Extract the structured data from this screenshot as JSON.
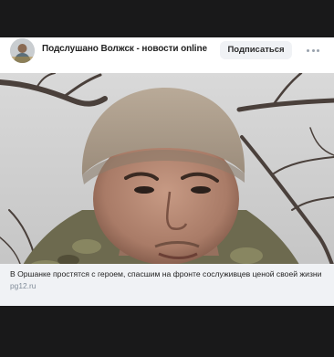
{
  "post": {
    "group_name": "Подслушано Волжск  - новости online",
    "subscribe_label": "Подписаться",
    "more_icon": "more-horizontal-icon",
    "avatar_icon": "group-avatar-icon",
    "link": {
      "title": "В Оршанке простятся с героем, спасшим на фронте сослуживцев ценой своей жизни",
      "source": "pg12.ru"
    }
  },
  "colors": {
    "page_background": "#19191a",
    "card_background": "#ffffff",
    "button_background": "#f0f2f5",
    "caption_background": "#f0f2f5",
    "secondary_text": "#818c99"
  }
}
